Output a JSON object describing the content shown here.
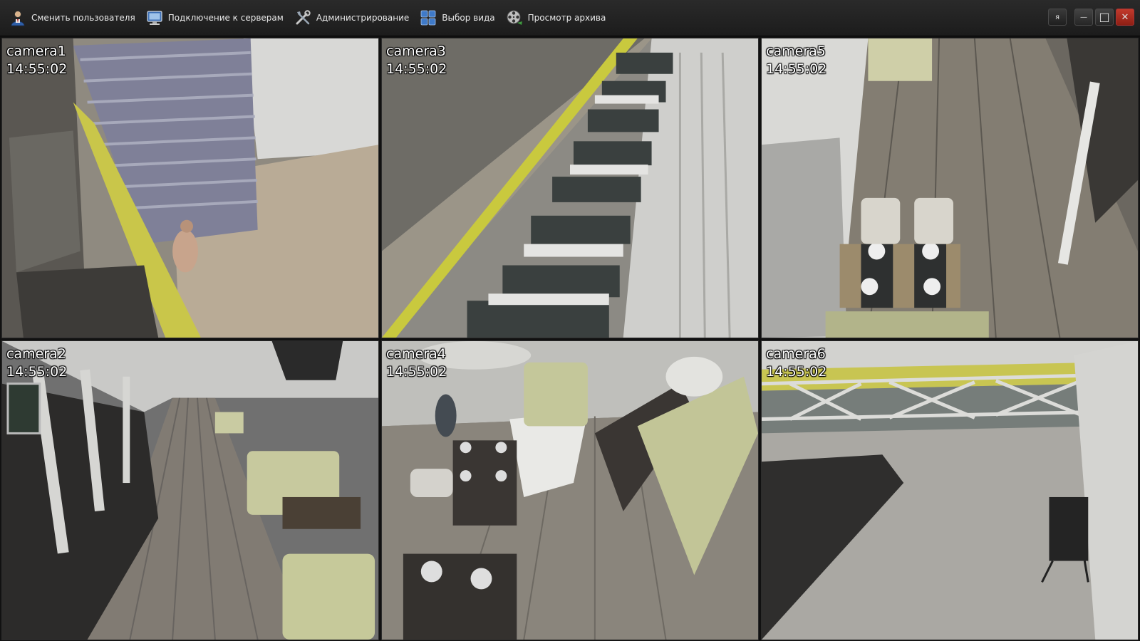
{
  "toolbar": {
    "items": [
      {
        "label": "Сменить пользователя",
        "icon": "user-switch-icon"
      },
      {
        "label": "Подключение к серверам",
        "icon": "server-connect-icon"
      },
      {
        "label": "Администрирование",
        "icon": "tools-icon"
      },
      {
        "label": "Выбор вида",
        "icon": "layout-grid-icon"
      },
      {
        "label": "Просмотр архива",
        "icon": "film-reel-icon"
      }
    ],
    "window_controls": {
      "language": "я",
      "minimize": "—",
      "maximize": "□",
      "close": "✕"
    }
  },
  "cameras": [
    {
      "name": "camera1",
      "time": "14:55:02"
    },
    {
      "name": "camera3",
      "time": "14:55:02"
    },
    {
      "name": "camera5",
      "time": "14:55:02"
    },
    {
      "name": "camera2",
      "time": "14:55:02"
    },
    {
      "name": "camera4",
      "time": "14:55:02"
    },
    {
      "name": "camera6",
      "time": "14:55:02"
    }
  ],
  "colors": {
    "toolbar_bg": "#222222",
    "toolbar_text": "#e8e8e8",
    "close_button": "#b0301f",
    "overlay_text": "#ffffff"
  }
}
